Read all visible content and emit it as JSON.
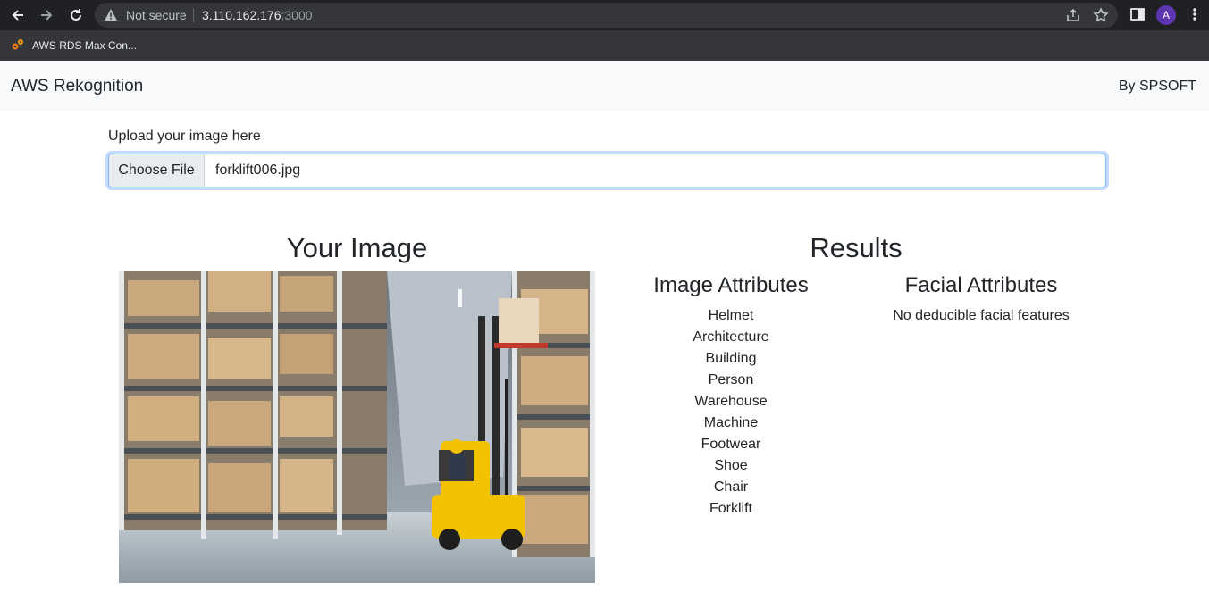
{
  "browser": {
    "security_label": "Not secure",
    "url_host": "3.110.162.176",
    "url_port": ":3000",
    "profile_initial": "A",
    "bookmark_label": "AWS RDS Max Con..."
  },
  "navbar": {
    "brand": "AWS Rekognition",
    "credit": "By SPSOFT"
  },
  "upload": {
    "label": "Upload your image here",
    "button": "Choose File",
    "file_name": "forklift006.jpg"
  },
  "image_section": {
    "heading": "Your Image"
  },
  "results": {
    "heading": "Results",
    "image_attributes": {
      "heading": "Image Attributes",
      "items": [
        "Helmet",
        "Architecture",
        "Building",
        "Person",
        "Warehouse",
        "Machine",
        "Footwear",
        "Shoe",
        "Chair",
        "Forklift"
      ]
    },
    "facial_attributes": {
      "heading": "Facial Attributes",
      "message": "No deducible facial features"
    }
  },
  "colors": {
    "chrome_dark": "#202124",
    "navbar_bg": "#f8f9fa",
    "focus_border": "#86b7fe",
    "forklift_yellow": "#f2c200"
  }
}
